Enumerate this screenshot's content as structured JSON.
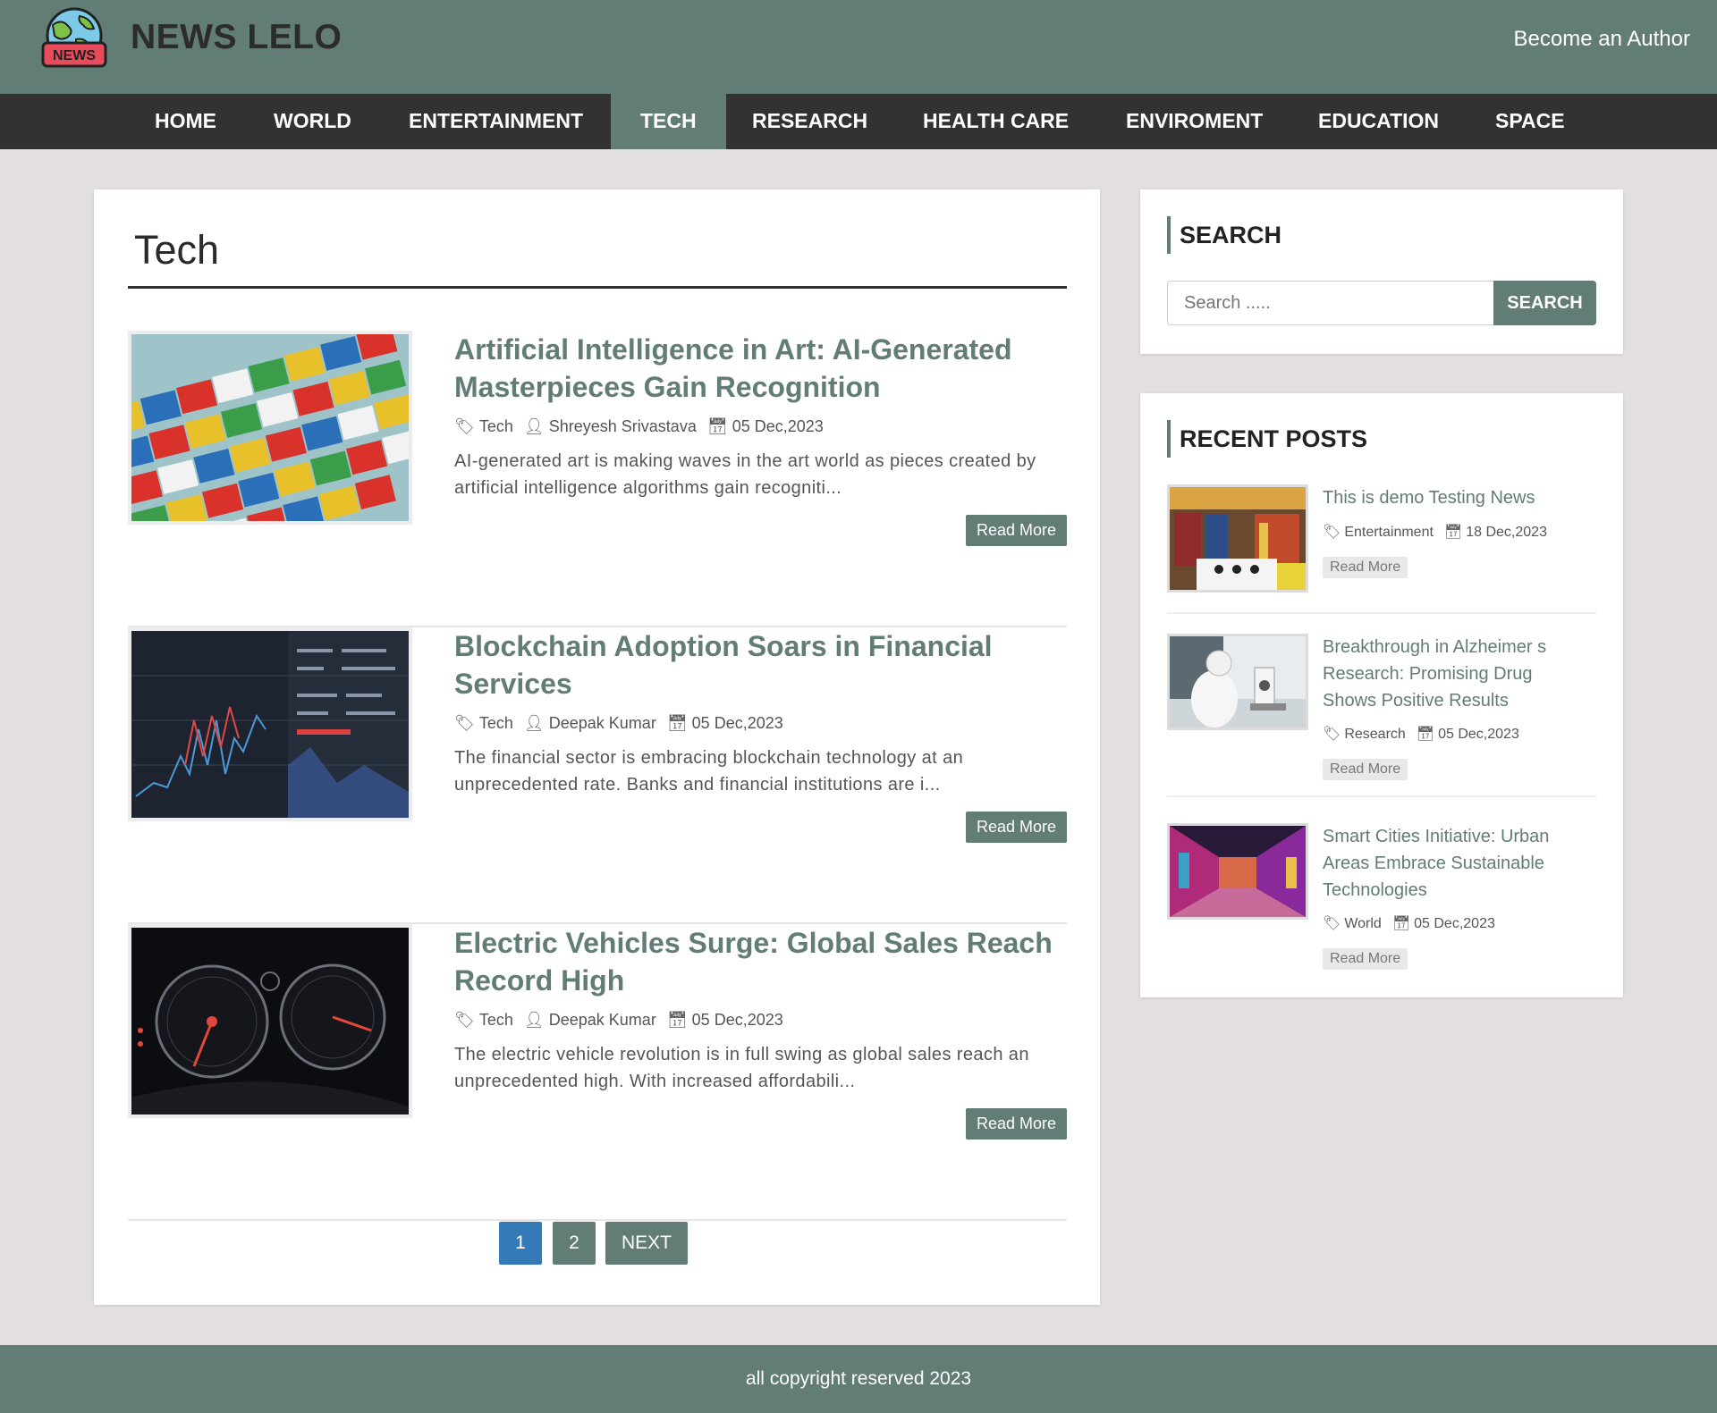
{
  "header": {
    "site_title": "NEWS LELO",
    "logo_badge": "NEWS",
    "author_link": "Become an Author"
  },
  "nav": {
    "items": [
      "HOME",
      "WORLD",
      "ENTERTAINMENT",
      "TECH",
      "RESEARCH",
      "HEALTH CARE",
      "ENVIROMENT",
      "EDUCATION",
      "SPACE"
    ],
    "active": "TECH"
  },
  "main": {
    "title": "Tech",
    "articles": [
      {
        "title": "Artificial Intelligence in Art: AI-Generated Masterpieces Gain Recognition",
        "category": "Tech",
        "author": "Shreyesh Srivastava",
        "date": "05 Dec,2023",
        "excerpt": "AI-generated art is making waves in the art world as pieces created by artificial intelligence algorithms gain recogniti...",
        "read_more": "Read More"
      },
      {
        "title": "Blockchain Adoption Soars in Financial Services",
        "category": "Tech",
        "author": "Deepak Kumar",
        "date": "05 Dec,2023",
        "excerpt": "The financial sector is embracing blockchain technology at an unprecedented rate. Banks and financial institutions are i...",
        "read_more": "Read More"
      },
      {
        "title": "Electric Vehicles Surge: Global Sales Reach Record High",
        "category": "Tech",
        "author": "Deepak Kumar",
        "date": "05 Dec,2023",
        "excerpt": "The electric vehicle revolution is in full swing as global sales reach an unprecedented high. With increased affordabili...",
        "read_more": "Read More"
      }
    ],
    "pagination": {
      "pages": [
        "1",
        "2"
      ],
      "current": "1",
      "next": "NEXT"
    }
  },
  "sidebar": {
    "search": {
      "title": "SEARCH",
      "placeholder": "Search .....",
      "button": "SEARCH"
    },
    "recent": {
      "title": "RECENT POSTS",
      "posts": [
        {
          "title": "This is demo Testing News",
          "category": "Entertainment",
          "date": "18 Dec,2023",
          "read_more": "Read More"
        },
        {
          "title": "Breakthrough in Alzheimer s Research: Promising Drug Shows Positive Results",
          "category": "Research",
          "date": "05 Dec,2023",
          "read_more": "Read More"
        },
        {
          "title": "Smart Cities Initiative: Urban Areas Embrace Sustainable Technologies",
          "category": "World",
          "date": "05 Dec,2023",
          "read_more": "Read More"
        }
      ]
    }
  },
  "footer": {
    "text": "all copyright reserved 2023"
  },
  "colors": {
    "accent": "#627c76",
    "nav_bg": "#323232",
    "page_bg": "#e3dfdf",
    "pager_active": "#337ab7"
  }
}
